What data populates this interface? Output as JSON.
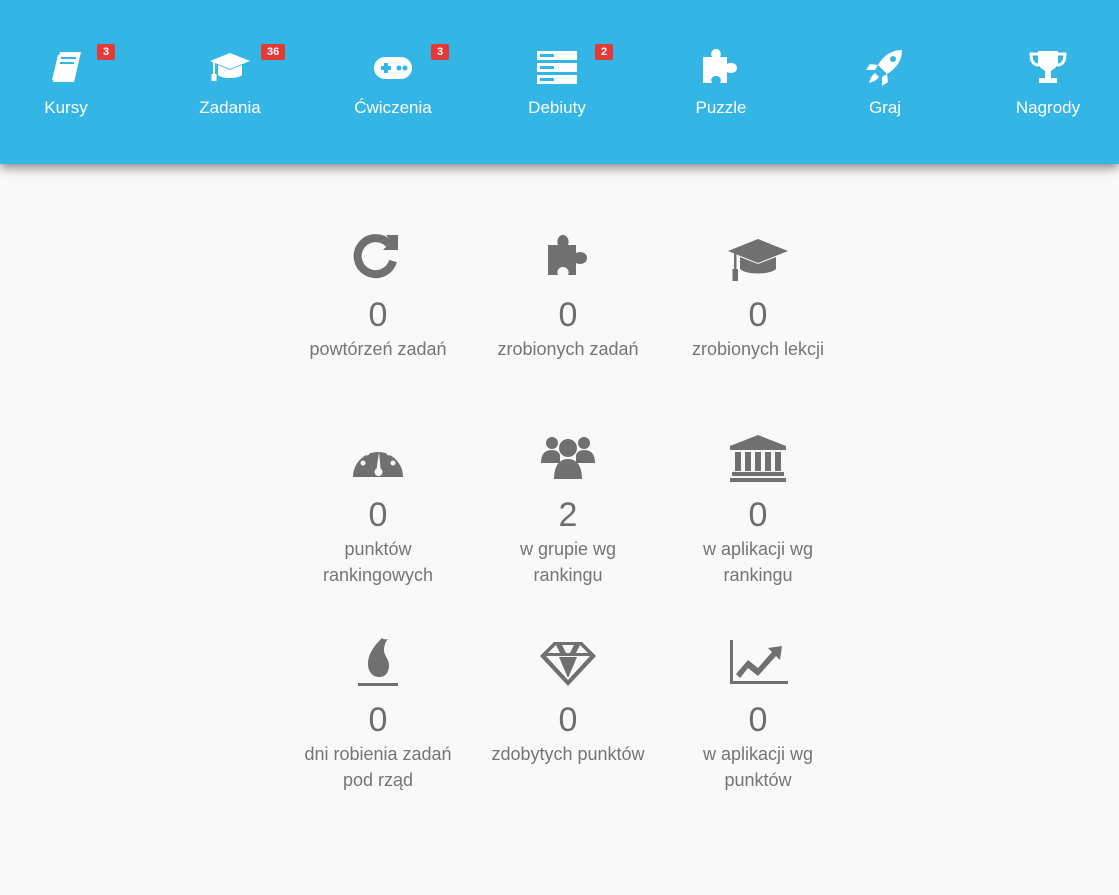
{
  "nav": {
    "items": [
      {
        "label": "Kursy",
        "badge": "3",
        "icon": "book-icon"
      },
      {
        "label": "Zadania",
        "badge": "36",
        "icon": "graduation-cap-icon"
      },
      {
        "label": "Ćwiczenia",
        "badge": "3",
        "icon": "gamepad-icon"
      },
      {
        "label": "Debiuty",
        "badge": "2",
        "icon": "server-icon"
      },
      {
        "label": "Puzzle",
        "icon": "puzzle-icon"
      },
      {
        "label": "Graj",
        "icon": "rocket-icon"
      },
      {
        "label": "Nagrody",
        "icon": "trophy-icon"
      }
    ],
    "colors": {
      "background": "#33b5e5",
      "badge": "#e53935",
      "text": "#ffffff"
    }
  },
  "stats": [
    {
      "value": "0",
      "label": "powtórzeń zadań",
      "icon": "refresh-icon"
    },
    {
      "value": "0",
      "label": "zrobionych zadań",
      "icon": "puzzle-icon"
    },
    {
      "value": "0",
      "label": "zrobionych lekcji",
      "icon": "graduation-cap-icon"
    },
    {
      "value": "0",
      "label": "punktów rankingowych",
      "icon": "speedometer-icon"
    },
    {
      "value": "2",
      "label": "w grupie wg rankingu",
      "icon": "users-icon"
    },
    {
      "value": "0",
      "label": "w aplikacji wg rankingu",
      "icon": "bank-icon"
    },
    {
      "value": "0",
      "label": "dni robienia zadań pod rząd",
      "icon": "fire-icon"
    },
    {
      "value": "0",
      "label": "zdobytych punktów",
      "icon": "diamond-icon"
    },
    {
      "value": "0",
      "label": "w aplikacji wg punktów",
      "icon": "chart-line-icon"
    }
  ],
  "colors": {
    "stat_text": "#707070",
    "page_background": "#f9f9f9"
  }
}
